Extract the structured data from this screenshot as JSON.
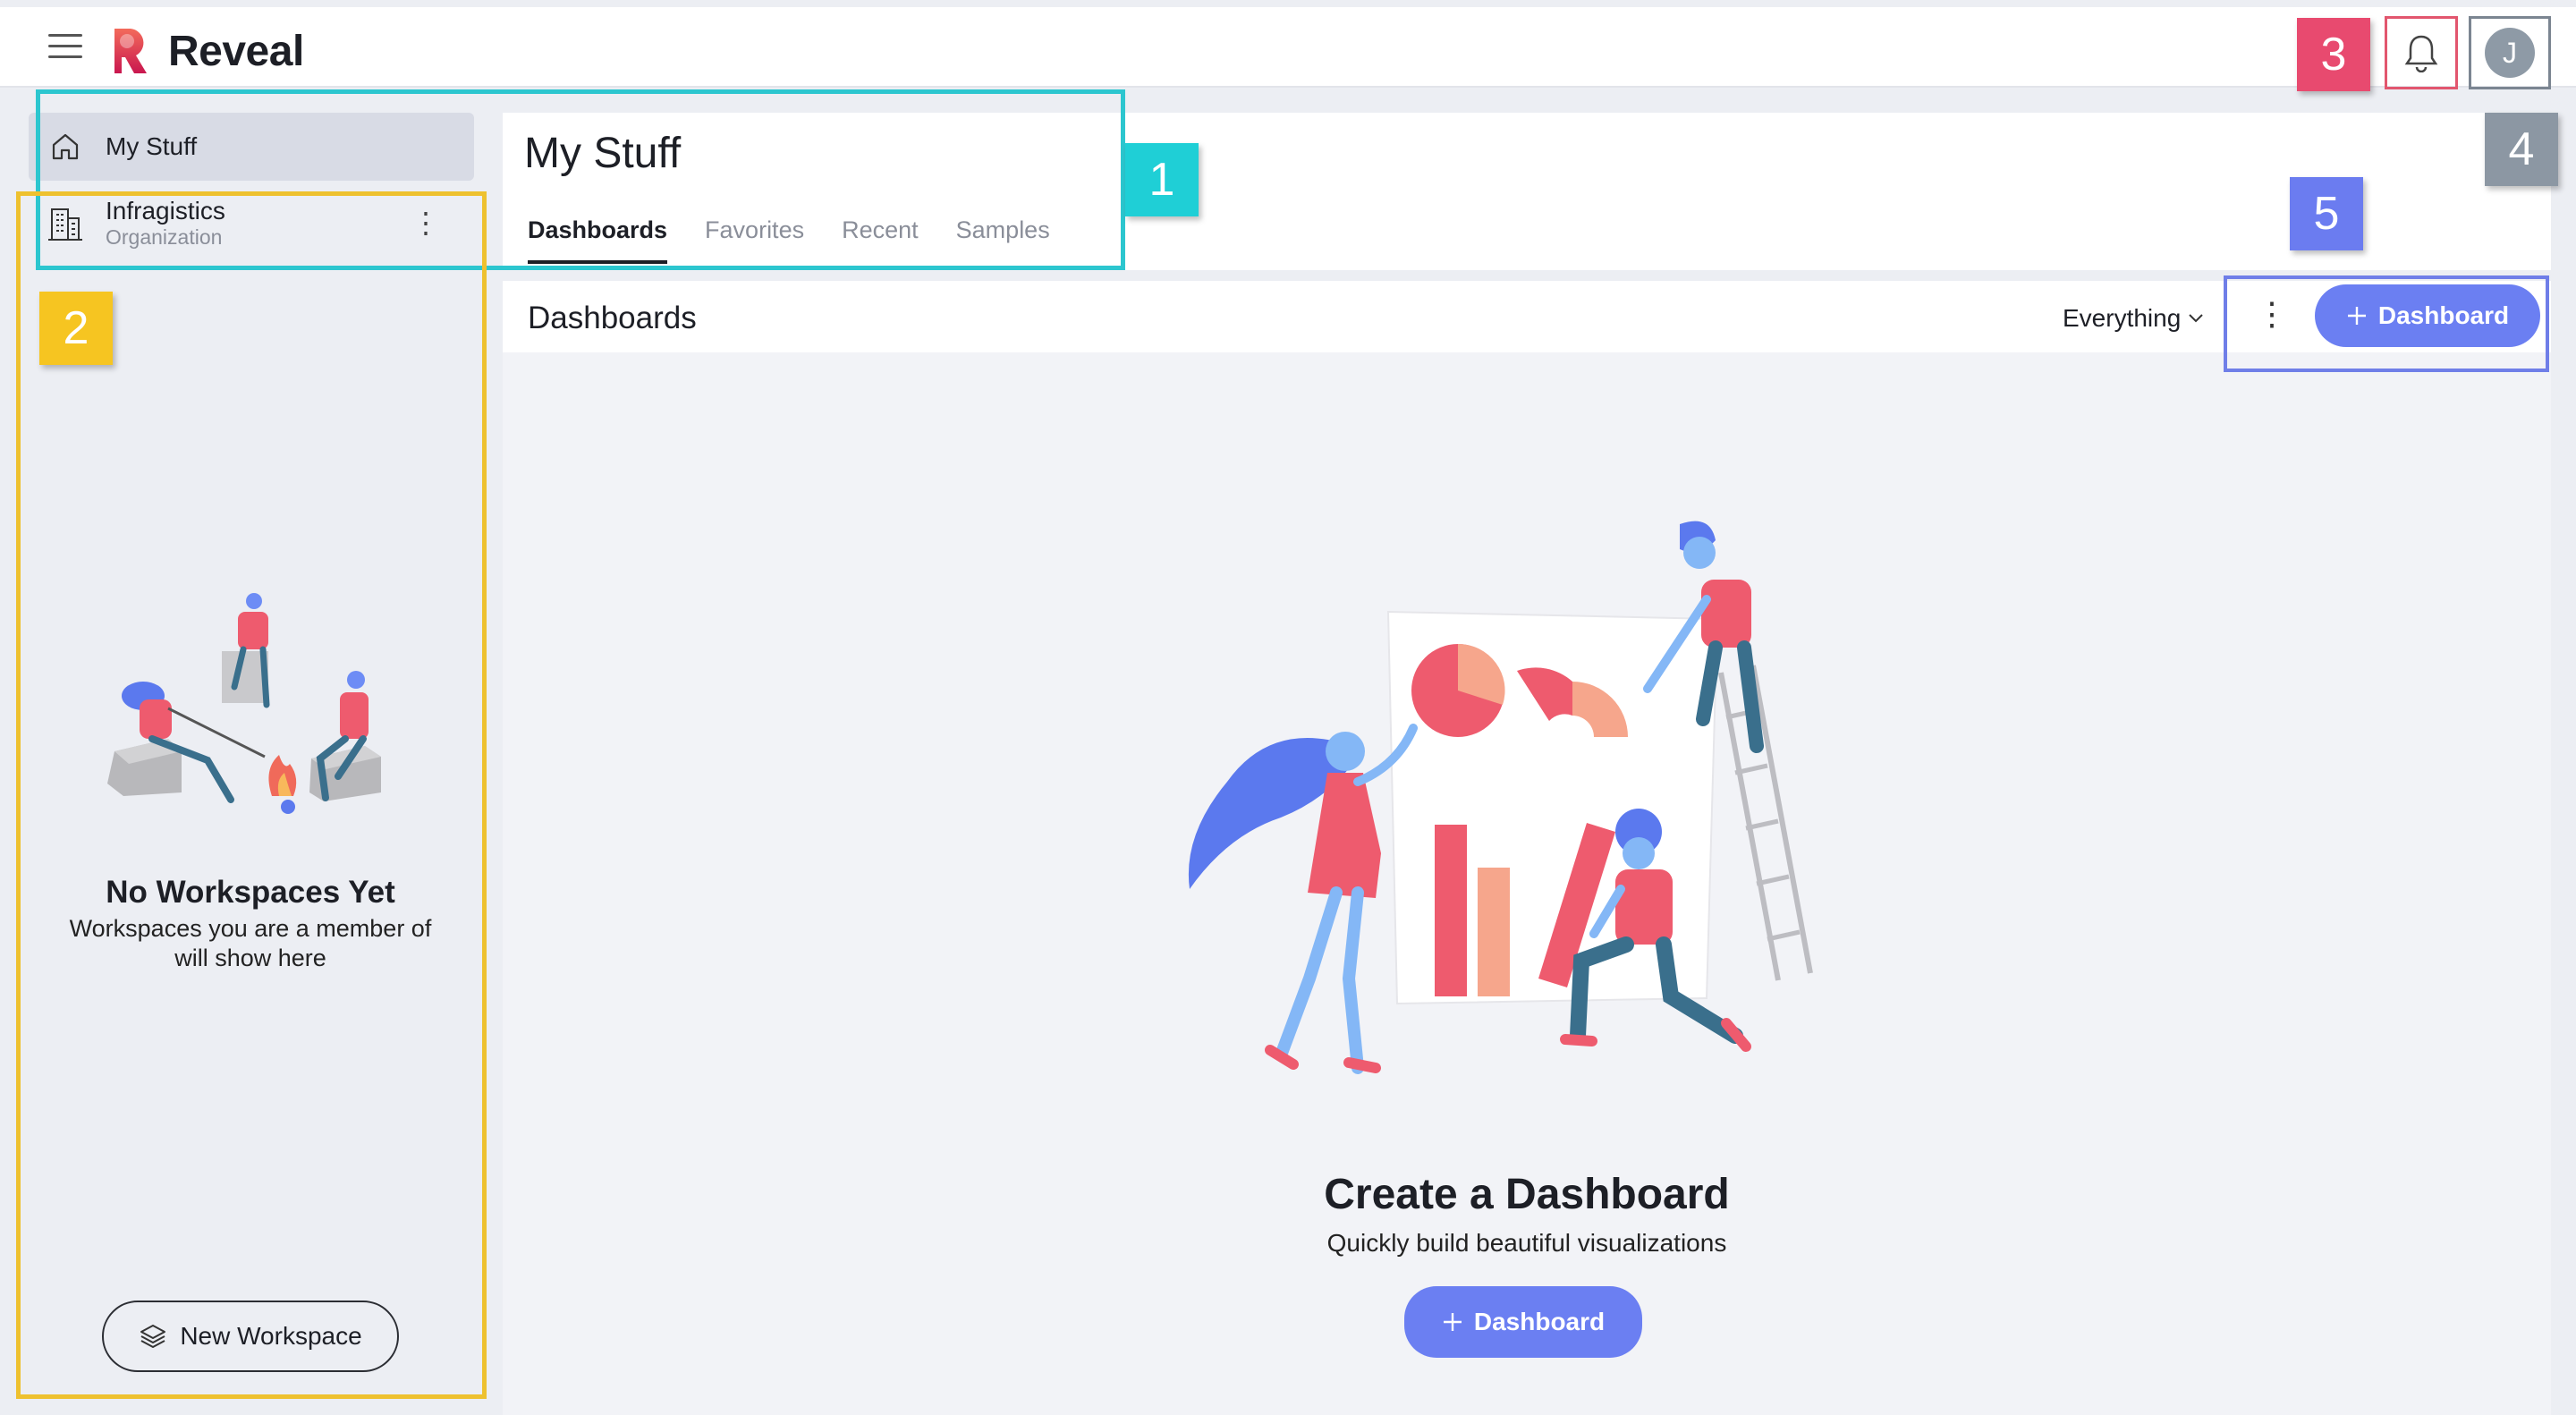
{
  "app": {
    "name": "Reveal"
  },
  "topbar": {
    "avatar_initial": "J"
  },
  "callouts": [
    "1",
    "2",
    "3",
    "4",
    "5"
  ],
  "sidebar": {
    "my_stuff_label": "My Stuff",
    "org": {
      "name": "Infragistics",
      "type": "Organization"
    },
    "empty_title": "No Workspaces Yet",
    "empty_desc": "Workspaces you are a member of will show here",
    "new_workspace_label": "New Workspace"
  },
  "header": {
    "title": "My Stuff",
    "tabs": [
      {
        "label": "Dashboards",
        "active": true
      },
      {
        "label": "Favorites",
        "active": false
      },
      {
        "label": "Recent",
        "active": false
      },
      {
        "label": "Samples",
        "active": false
      }
    ]
  },
  "toolbar": {
    "section_title": "Dashboards",
    "filter_value": "Everything",
    "add_label": "Dashboard"
  },
  "empty_state": {
    "title": "Create a Dashboard",
    "desc": "Quickly build beautiful visualizations",
    "button_label": "Dashboard"
  },
  "colors": {
    "accent": "#6b7ff2",
    "brand_pink": "#e84a6f",
    "callout_cyan": "#1fcfd6",
    "callout_yellow": "#f6c521",
    "callout_gray": "#8c97a3",
    "callout_blue": "#6b7cf0"
  },
  "icons": [
    "menu-icon",
    "reveal-logo-icon",
    "bell-icon",
    "home-icon",
    "building-icon",
    "kebab-icon",
    "layers-icon",
    "chevron-down-icon",
    "plus-icon"
  ]
}
